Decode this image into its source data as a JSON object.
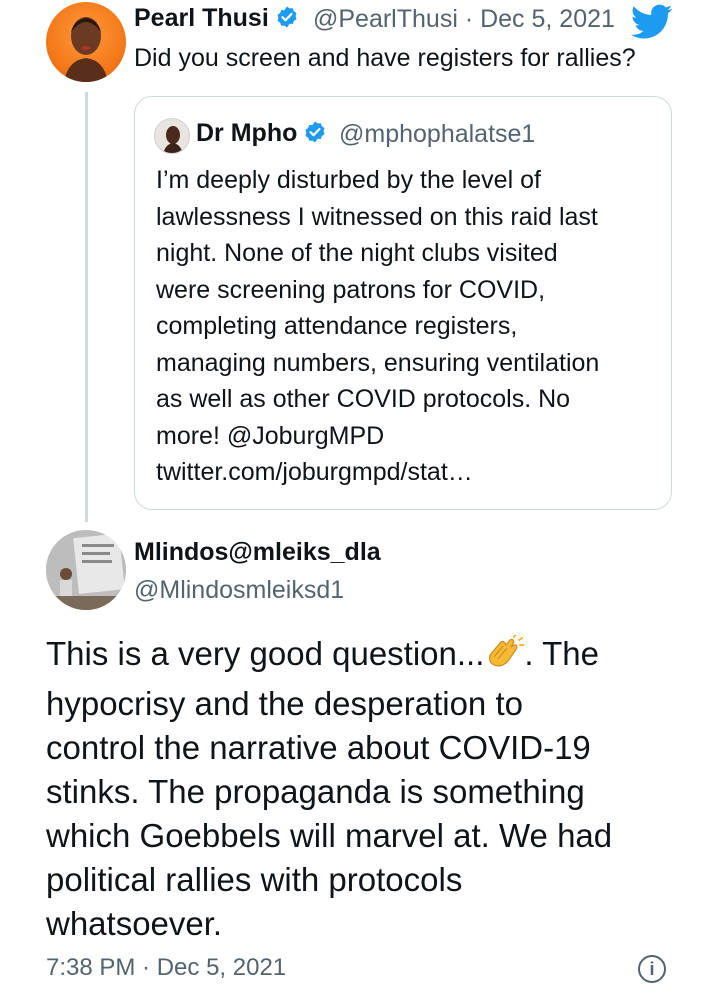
{
  "main_tweet": {
    "author_name": "Pearl Thusi",
    "handle": "@PearlThusi",
    "date": "Dec 5, 2021",
    "text": "Did you screen and have registers for rallies?"
  },
  "quoted_tweet": {
    "author_name": "Dr Mpho",
    "handle": "@mphophalatse1",
    "lines": [
      "I’m deeply disturbed by the level of",
      "lawlessness I witnessed on this raid last",
      "night. None of the night clubs visited",
      "were screening patrons for COVID,",
      "completing attendance registers,",
      "managing numbers, ensuring ventilation",
      "as well as other COVID protocols. No",
      "more! @JoburgMPD",
      "twitter.com/joburgmpd/stat…"
    ]
  },
  "reply_tweet": {
    "author_name": "Mlindos@mleiks_dla",
    "handle": "@Mlindosmleiksd1",
    "line1_before": "This is a very good question...",
    "line1_after": ". The",
    "lines": [
      "hypocrisy and the desperation to",
      "control the narrative about COVID-19",
      "stinks. The propaganda is something",
      "which Goebbels will marvel at. We had",
      "political rallies with protocols",
      "whatsoever."
    ],
    "time": "7:38 PM",
    "date": "Dec 5, 2021"
  },
  "icons": {
    "verified": "verified-badge-icon",
    "twitter": "twitter-bird-icon",
    "clap": "clapping-hands-emoji",
    "info": "info-icon"
  },
  "colors": {
    "verified_blue": "#1d9bf0",
    "twitter_blue": "#1d9bf0",
    "secondary_text": "#536471",
    "border": "#cfd9de"
  }
}
